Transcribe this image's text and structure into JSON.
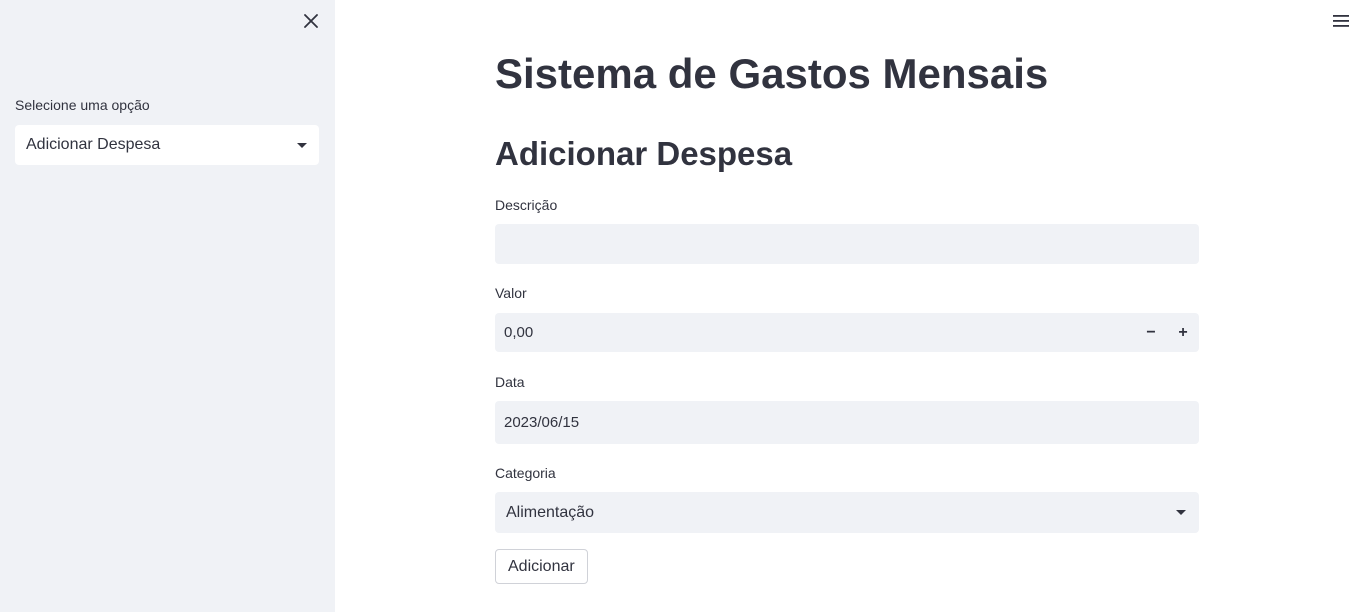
{
  "sidebar": {
    "select_label": "Selecione uma opção",
    "select_value": "Adicionar Despesa"
  },
  "main": {
    "title": "Sistema de Gastos Mensais",
    "section_title": "Adicionar Despesa",
    "fields": {
      "descricao_label": "Descrição",
      "descricao_value": "",
      "valor_label": "Valor",
      "valor_value": "0,00",
      "valor_decrement": "−",
      "valor_increment": "+",
      "data_label": "Data",
      "data_value": "2023/06/15",
      "categoria_label": "Categoria",
      "categoria_value": "Alimentação"
    },
    "submit_label": "Adicionar"
  },
  "icons": {
    "close": "close-icon",
    "menu": "hamburger-menu-icon",
    "caret": "chevron-down-icon"
  },
  "colors": {
    "sidebar_bg": "#f0f2f6",
    "input_bg": "#f0f2f6",
    "text": "#31333f"
  }
}
